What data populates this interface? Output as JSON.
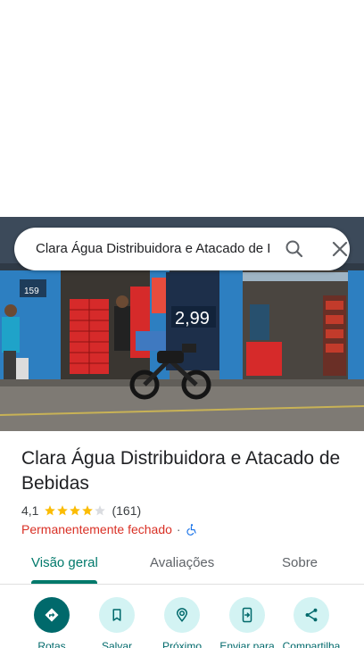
{
  "search": {
    "query": "Clara Água Distribuidora e Atacado de Bebidas"
  },
  "photo": {
    "storefront_price": "2,99",
    "sign_number": "159"
  },
  "place": {
    "title": "Clara Água Distribuidora e Atacado de Bebidas",
    "rating": "4,1",
    "stars_filled": 4,
    "review_count": "(161)",
    "status": "Permanentemente fechado",
    "separator": "·"
  },
  "tabs": [
    {
      "label": "Visão geral",
      "active": true
    },
    {
      "label": "Avaliações",
      "active": false
    },
    {
      "label": "Sobre",
      "active": false
    }
  ],
  "actions": [
    {
      "label": "Rotas",
      "icon": "directions-icon"
    },
    {
      "label": "Salvar",
      "icon": "bookmark-icon"
    },
    {
      "label": "Próximo",
      "icon": "nearby-icon"
    },
    {
      "label": "Enviar para",
      "icon": "send-to-phone-icon"
    },
    {
      "label": "Compartilha",
      "icon": "share-icon"
    }
  ],
  "colors": {
    "accent": "#00796b",
    "closed": "#d93025",
    "star": "#fbbc04",
    "action_bg": "#d3f3f3"
  }
}
